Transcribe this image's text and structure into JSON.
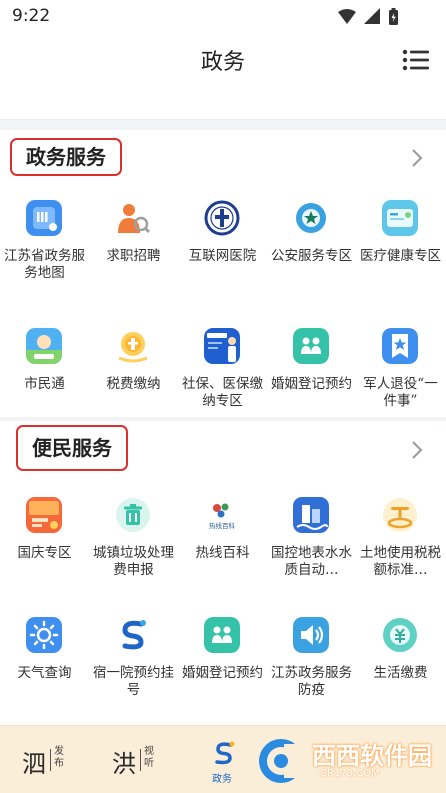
{
  "status": {
    "time": "9:22"
  },
  "header": {
    "title": "政务"
  },
  "sections": [
    {
      "title": "政务服务",
      "items": [
        {
          "label": "江苏省政务服务地图",
          "icon": "map-book-icon"
        },
        {
          "label": "求职招聘",
          "icon": "job-person-icon"
        },
        {
          "label": "互联网医院",
          "icon": "hospital-emblem-icon"
        },
        {
          "label": "公安服务专区",
          "icon": "police-badge-icon"
        },
        {
          "label": "医疗健康专区",
          "icon": "health-card-icon"
        },
        {
          "label": "市民通",
          "icon": "citizen-card-icon"
        },
        {
          "label": "税费缴纳",
          "icon": "tax-coin-icon"
        },
        {
          "label": "社保、医保缴纳专区",
          "icon": "insurance-banner-icon"
        },
        {
          "label": "婚姻登记预约",
          "icon": "marriage-couple-icon"
        },
        {
          "label": "军人退役“一件事”",
          "icon": "veteran-star-icon"
        }
      ]
    },
    {
      "title": "便民服务",
      "items": [
        {
          "label": "国庆专区",
          "icon": "national-day-icon"
        },
        {
          "label": "城镇垃圾处理费申报",
          "icon": "trash-bin-icon"
        },
        {
          "label": "热线百科",
          "icon": "hotline-baike-icon"
        },
        {
          "label": "国控地表水水质自动…",
          "icon": "water-station-icon"
        },
        {
          "label": "土地使用税税额标准…",
          "icon": "land-tax-icon"
        },
        {
          "label": "天气查询",
          "icon": "weather-sun-icon"
        },
        {
          "label": "宿一院预约挂号",
          "icon": "hospital-s-logo-icon"
        },
        {
          "label": "婚姻登记预约",
          "icon": "marriage-couple-icon"
        },
        {
          "label": "江苏政务服务防疫",
          "icon": "speaker-icon"
        },
        {
          "label": "生活缴费",
          "icon": "bill-payment-icon"
        }
      ]
    }
  ],
  "hotline_logo_text": "热线百科",
  "tabbar": {
    "tabs": [
      {
        "big": "泗",
        "small": "发布"
      },
      {
        "big": "洪",
        "small": "视听"
      },
      {
        "label": "政务",
        "active": true
      }
    ],
    "watermark_main": "西西软件园",
    "watermark_sub": "CR173.COM"
  },
  "colors": {
    "accent_red": "#d9302a",
    "tab_active_blue": "#1a66c9",
    "tabbar_bg": "#fbeed8"
  }
}
